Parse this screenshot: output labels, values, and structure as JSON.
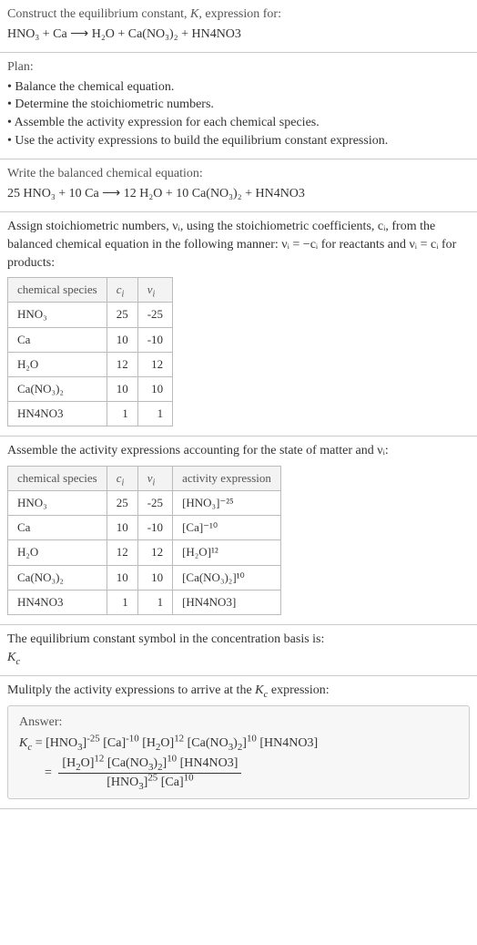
{
  "header": {
    "title": "Construct the equilibrium constant, K, expression for:",
    "equation": "HNO₃ + Ca ⟶ H₂O + Ca(NO₃)₂ + HN4NO3"
  },
  "plan": {
    "label": "Plan:",
    "items": [
      "Balance the chemical equation.",
      "Determine the stoichiometric numbers.",
      "Assemble the activity expression for each chemical species.",
      "Use the activity expressions to build the equilibrium constant expression."
    ]
  },
  "balanced": {
    "label": "Write the balanced chemical equation:",
    "equation": "25 HNO₃ + 10 Ca ⟶ 12 H₂O + 10 Ca(NO₃)₂ + HN4NO3"
  },
  "stoich": {
    "intro_a": "Assign stoichiometric numbers, νᵢ, using the stoichiometric coefficients, cᵢ, from the balanced chemical equation in the following manner: νᵢ = −cᵢ for reactants and νᵢ = cᵢ for products:",
    "headers": {
      "species": "chemical species",
      "ci": "cᵢ",
      "vi": "νᵢ"
    },
    "rows": [
      {
        "species": "HNO₃",
        "ci": "25",
        "vi": "-25"
      },
      {
        "species": "Ca",
        "ci": "10",
        "vi": "-10"
      },
      {
        "species": "H₂O",
        "ci": "12",
        "vi": "12"
      },
      {
        "species": "Ca(NO₃)₂",
        "ci": "10",
        "vi": "10"
      },
      {
        "species": "HN4NO3",
        "ci": "1",
        "vi": "1"
      }
    ]
  },
  "activity": {
    "intro": "Assemble the activity expressions accounting for the state of matter and νᵢ:",
    "headers": {
      "species": "chemical species",
      "ci": "cᵢ",
      "vi": "νᵢ",
      "expr": "activity expression"
    },
    "rows": [
      {
        "species": "HNO₃",
        "ci": "25",
        "vi": "-25",
        "expr": "[HNO₃]⁻²⁵"
      },
      {
        "species": "Ca",
        "ci": "10",
        "vi": "-10",
        "expr": "[Ca]⁻¹⁰"
      },
      {
        "species": "H₂O",
        "ci": "12",
        "vi": "12",
        "expr": "[H₂O]¹²"
      },
      {
        "species": "Ca(NO₃)₂",
        "ci": "10",
        "vi": "10",
        "expr": "[Ca(NO₃)₂]¹⁰"
      },
      {
        "species": "HN4NO3",
        "ci": "1",
        "vi": "1",
        "expr": "[HN4NO3]"
      }
    ]
  },
  "kc_symbol": {
    "line1": "The equilibrium constant symbol in the concentration basis is:",
    "line2": "K𝒸"
  },
  "multiply": {
    "label": "Mulitply the activity expressions to arrive at the K𝒸 expression:"
  },
  "answer": {
    "label": "Answer:",
    "line1": "K𝒸 = [HNO₃]⁻²⁵ [Ca]⁻¹⁰ [H₂O]¹² [Ca(NO₃)₂]¹⁰ [HN4NO3]",
    "eq_sign": "= ",
    "frac_num": "[H₂O]¹² [Ca(NO₃)₂]¹⁰ [HN4NO3]",
    "frac_den": "[HNO₃]²⁵ [Ca]¹⁰"
  }
}
